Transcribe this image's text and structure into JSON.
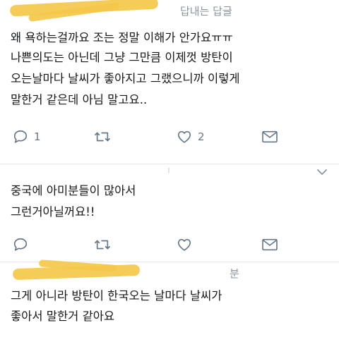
{
  "tweets": [
    {
      "header_partial": "답내는 답글",
      "lines": [
        "왜 욕하는걸까요 조는 정말 이해가 안가요ㅠㅠ",
        "나쁜의도는 아닌데 그냥 그만큼 이제껏 방탄이",
        "오는날마다 날씨가 좋아지고 그랬으니까 이렇게",
        "말한거 같은데 아님 말고요.."
      ],
      "reply_count": "1",
      "like_count": "2"
    },
    {
      "lines": [
        "중국에 아미분들이 많아서",
        "그런거아닐꺼요!!"
      ]
    },
    {
      "header_partial": "분",
      "lines": [
        "그게 아니라 방탄이 한국오는 날마다 날씨가",
        "좋아서 말한거 같아요"
      ]
    }
  ],
  "colors": {
    "icon": "#657786",
    "divider": "#e1e8ed",
    "scribble": "#f4c84a"
  },
  "icons": [
    "reply-icon",
    "retweet-icon",
    "like-icon",
    "share-icon",
    "chevron-down-icon"
  ]
}
